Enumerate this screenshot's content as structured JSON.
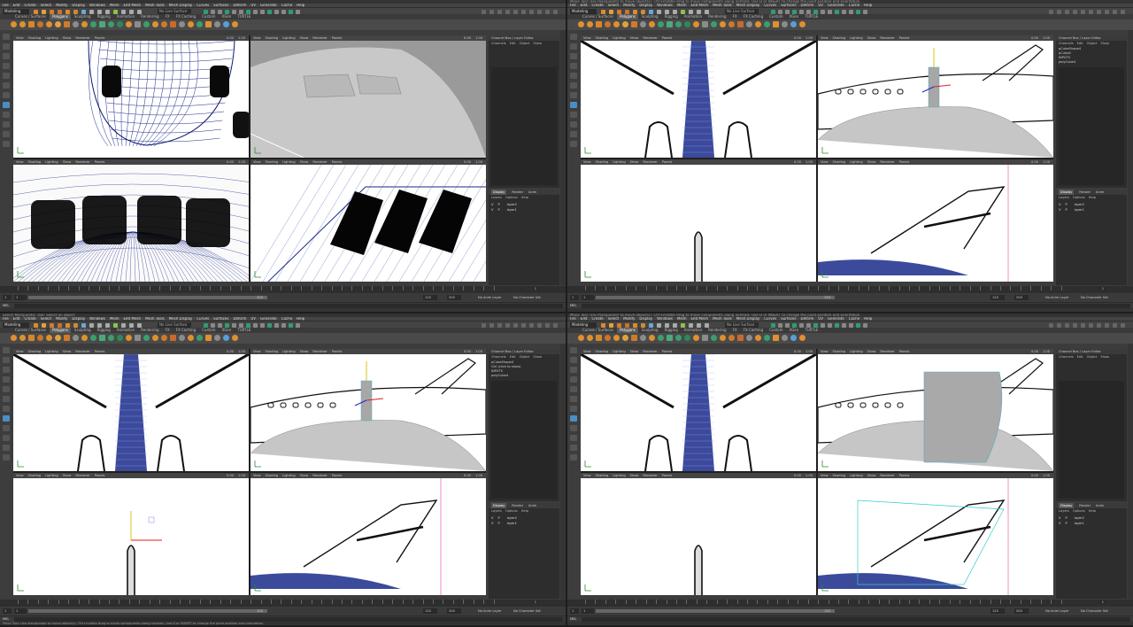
{
  "menus_common": [
    "File",
    "Edit",
    "Create",
    "Select",
    "Modify",
    "Display",
    "Windows",
    "Mesh",
    "Edit Mesh",
    "Mesh Tools",
    "Mesh Display",
    "Curves",
    "Surfaces",
    "Deform",
    "UV",
    "Generate",
    "Cache",
    "Help"
  ],
  "mode_menu": "Modeling",
  "live_surface": "No Live Surface",
  "shelf_tabs": [
    "Curves / Surfaces",
    "Polygons",
    "Sculpting",
    "Rigging",
    "Animation",
    "Rendering",
    "FX",
    "FX Caching",
    "Custom",
    "XGen",
    "TURTLE"
  ],
  "shelf_active": "Polygons",
  "viewport_menus": [
    "View",
    "Shading",
    "Lighting",
    "Show",
    "Renderer",
    "Panels"
  ],
  "viewport_values": {
    "field1": "0.00",
    "field2": "1.00"
  },
  "channel_tabs": "Channel Box / Layer Editor",
  "channel_menus": [
    "Channels",
    "Edit",
    "Object",
    "Show"
  ],
  "layer_tabs": [
    "Display",
    "Render",
    "Anim"
  ],
  "layer_menus": [
    "Layers",
    "Options",
    "Help"
  ],
  "layers": [
    {
      "vis": "V",
      "ref": "P",
      "name": "layer2"
    },
    {
      "vis": "V",
      "ref": "P",
      "name": "layer1"
    }
  ],
  "timeline": {
    "start": "1",
    "end": "120",
    "range_start": "1",
    "range_end": "120",
    "anim_end": "200",
    "current": "1",
    "anim_layer": "No Anim Layer",
    "char_set": "No Character Set"
  },
  "mel_label": "MEL",
  "quads": [
    {
      "id": "top-left",
      "hint": "",
      "help": "",
      "channel_items": []
    },
    {
      "id": "top-right",
      "hint": "Move Tool: Use manipulator to move object(s). Ctrl+middle-drag to move components along normals. Use D or INSERT to change the pivot position and orientation.",
      "help": "",
      "channel_items": [
        "pCubeShape4",
        "pCube4",
        "INPUTS",
        "polyCube4"
      ]
    },
    {
      "id": "bottom-left",
      "hint": "Select Manipulator Tool: Select an object",
      "help": "Move Tool: Use manipulator to move object(s). Ctrl+middle-drag to move components along normals. Use D or INSERT to change the pivot position and orientation.",
      "channel_items": [
        "pCubeShape4",
        "Ctrl (click to show)",
        "INPUTS",
        "polyCube4"
      ]
    },
    {
      "id": "bottom-right",
      "hint": "Move Tool: Use manipulator to move object(s). Ctrl+middle-drag to move components along normals. Use D or INSERT to change the pivot position and orientation.",
      "help": "",
      "channel_items": []
    }
  ]
}
